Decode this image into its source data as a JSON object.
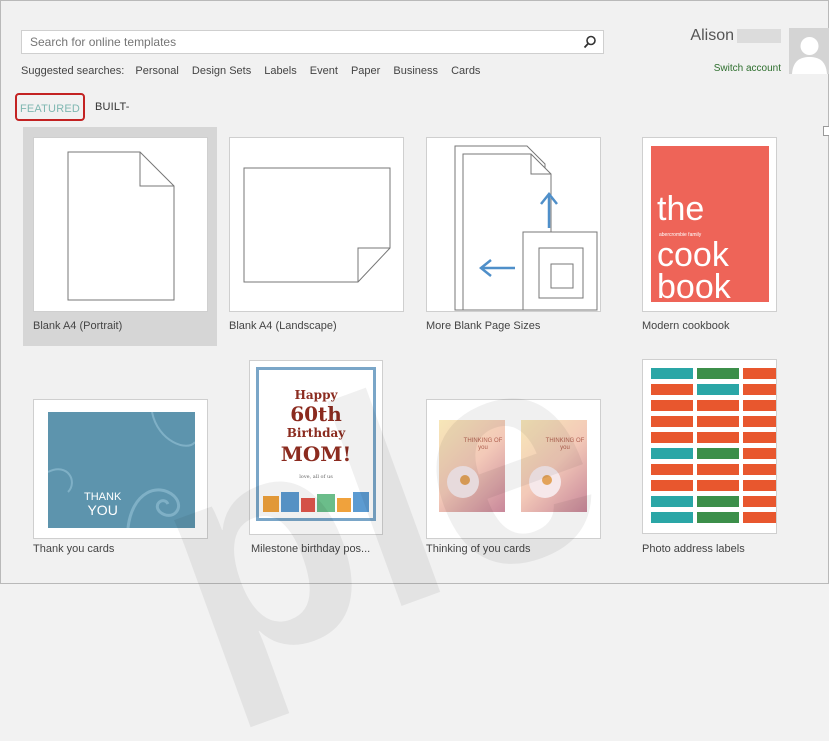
{
  "search": {
    "placeholder": "Search for online templates"
  },
  "suggested": {
    "label": "Suggested searches:",
    "items": [
      "Personal",
      "Design Sets",
      "Labels",
      "Event",
      "Paper",
      "Business",
      "Cards"
    ]
  },
  "tabs": {
    "featured": "FEATURED",
    "builtin": "BUILT-IN"
  },
  "user": {
    "name": "Alison",
    "switch": "Switch account"
  },
  "templates": [
    {
      "label": "Blank A4 (Portrait)"
    },
    {
      "label": "Blank A4 (Landscape)"
    },
    {
      "label": "More Blank Page Sizes"
    },
    {
      "label": "Modern cookbook"
    },
    {
      "label": "Thank you cards"
    },
    {
      "label": "Milestone birthday pos..."
    },
    {
      "label": "Thinking of you cards"
    },
    {
      "label": "Photo address labels"
    }
  ],
  "cookbook": {
    "line1": "the",
    "line2": "cook",
    "line3": "book",
    "small": "abercrombie family"
  },
  "thankyou": {
    "line1": "THANK",
    "line2": "YOU"
  },
  "birthday": {
    "line1": "Happy",
    "line2": "60th",
    "line3": "Birthday",
    "line4": "MOM!",
    "small": "love, all of us"
  },
  "thinking": {
    "text": "THINKING OF you"
  },
  "watermark": "ple",
  "colors": {
    "accent": "#7fb7b1",
    "highlight_border": "#c32222",
    "link": "#2e6f2e"
  }
}
